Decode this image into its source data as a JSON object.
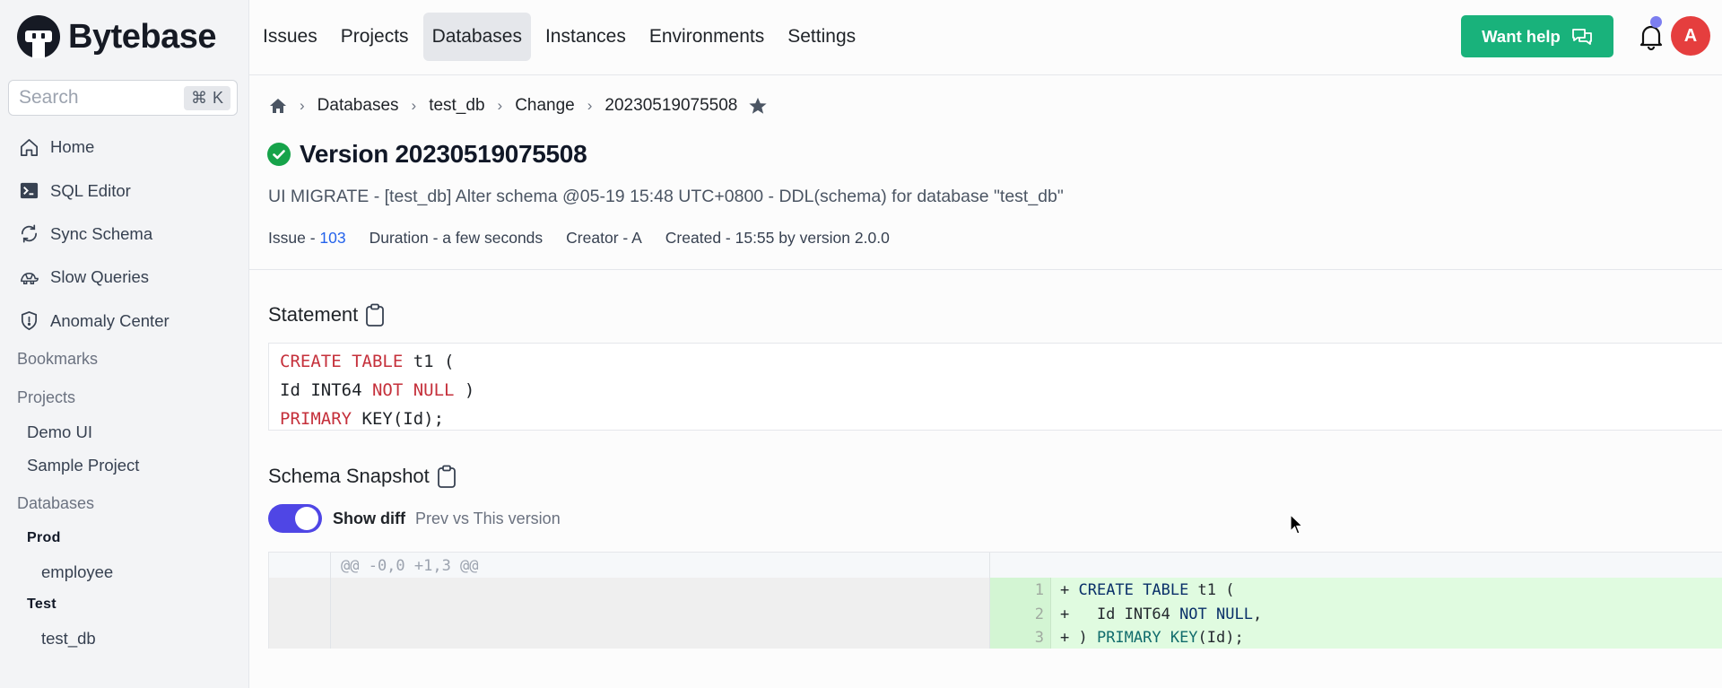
{
  "brand": {
    "name": "Bytebase"
  },
  "sidebar": {
    "search": {
      "placeholder": "Search",
      "shortcut_symbol": "⌘",
      "shortcut_key": "K"
    },
    "nav_items": [
      {
        "label": "Home",
        "icon": "home-icon"
      },
      {
        "label": "SQL Editor",
        "icon": "terminal-icon"
      },
      {
        "label": "Sync Schema",
        "icon": "sync-icon"
      },
      {
        "label": "Slow Queries",
        "icon": "turtle-icon"
      },
      {
        "label": "Anomaly Center",
        "icon": "shield-alert-icon"
      }
    ],
    "bookmarks_label": "Bookmarks",
    "projects_label": "Projects",
    "projects": [
      "Demo UI",
      "Sample Project"
    ],
    "databases_label": "Databases",
    "environments": [
      {
        "name": "Prod",
        "databases": [
          "employee"
        ]
      },
      {
        "name": "Test",
        "databases": [
          "test_db"
        ]
      }
    ]
  },
  "topbar": {
    "nav": [
      {
        "label": "Issues",
        "active": false
      },
      {
        "label": "Projects",
        "active": false
      },
      {
        "label": "Databases",
        "active": true
      },
      {
        "label": "Instances",
        "active": false
      },
      {
        "label": "Environments",
        "active": false
      },
      {
        "label": "Settings",
        "active": false
      }
    ],
    "help_button": "Want help",
    "avatar_initial": "A",
    "colors": {
      "help": "#19b27b",
      "avatar": "#e53e3e",
      "notification_dot": "#7c7ef0"
    }
  },
  "breadcrumb": {
    "items": [
      "Databases",
      "test_db",
      "Change",
      "20230519075508"
    ]
  },
  "version": {
    "title": "Version 20230519075508",
    "status": "done",
    "description": "UI MIGRATE - [test_db] Alter schema @05-19 15:48 UTC+0800 - DDL(schema) for database \"test_db\"",
    "meta": {
      "issue_label": "Issue - ",
      "issue_value": "103",
      "duration": "Duration - a few seconds",
      "creator": "Creator - A",
      "created": "Created - 15:55 by version 2.0.0"
    }
  },
  "statement": {
    "title": "Statement",
    "lines": [
      [
        {
          "t": "CREATE TABLE",
          "k": true
        },
        {
          "t": " t1 (",
          "k": false
        }
      ],
      [
        {
          "t": "Id INT64 ",
          "k": false
        },
        {
          "t": "NOT NULL",
          "k": true
        },
        {
          "t": " )",
          "k": false
        }
      ],
      [
        {
          "t": "PRIMARY",
          "k": true
        },
        {
          "t": " KEY(Id);",
          "k": false
        }
      ]
    ]
  },
  "schema_snapshot": {
    "title": "Schema Snapshot",
    "show_diff_label": "Show diff",
    "show_diff_enabled": true,
    "compare_label": "Prev vs This version",
    "hunk_header": "@@ -0,0 +1,3 @@",
    "added_lines": [
      {
        "num": "1",
        "segments": [
          {
            "t": "+ ",
            "c": ""
          },
          {
            "t": "CREATE TABLE",
            "c": "k2"
          },
          {
            "t": " t1 (",
            "c": ""
          }
        ]
      },
      {
        "num": "2",
        "segments": [
          {
            "t": "+   Id INT64 ",
            "c": ""
          },
          {
            "t": "NOT NULL",
            "c": "k2"
          },
          {
            "t": ",",
            "c": ""
          }
        ]
      },
      {
        "num": "3",
        "segments": [
          {
            "t": "+ ) ",
            "c": ""
          },
          {
            "t": "PRIMARY KEY",
            "c": "k3"
          },
          {
            "t": "(Id);",
            "c": ""
          }
        ]
      }
    ]
  }
}
